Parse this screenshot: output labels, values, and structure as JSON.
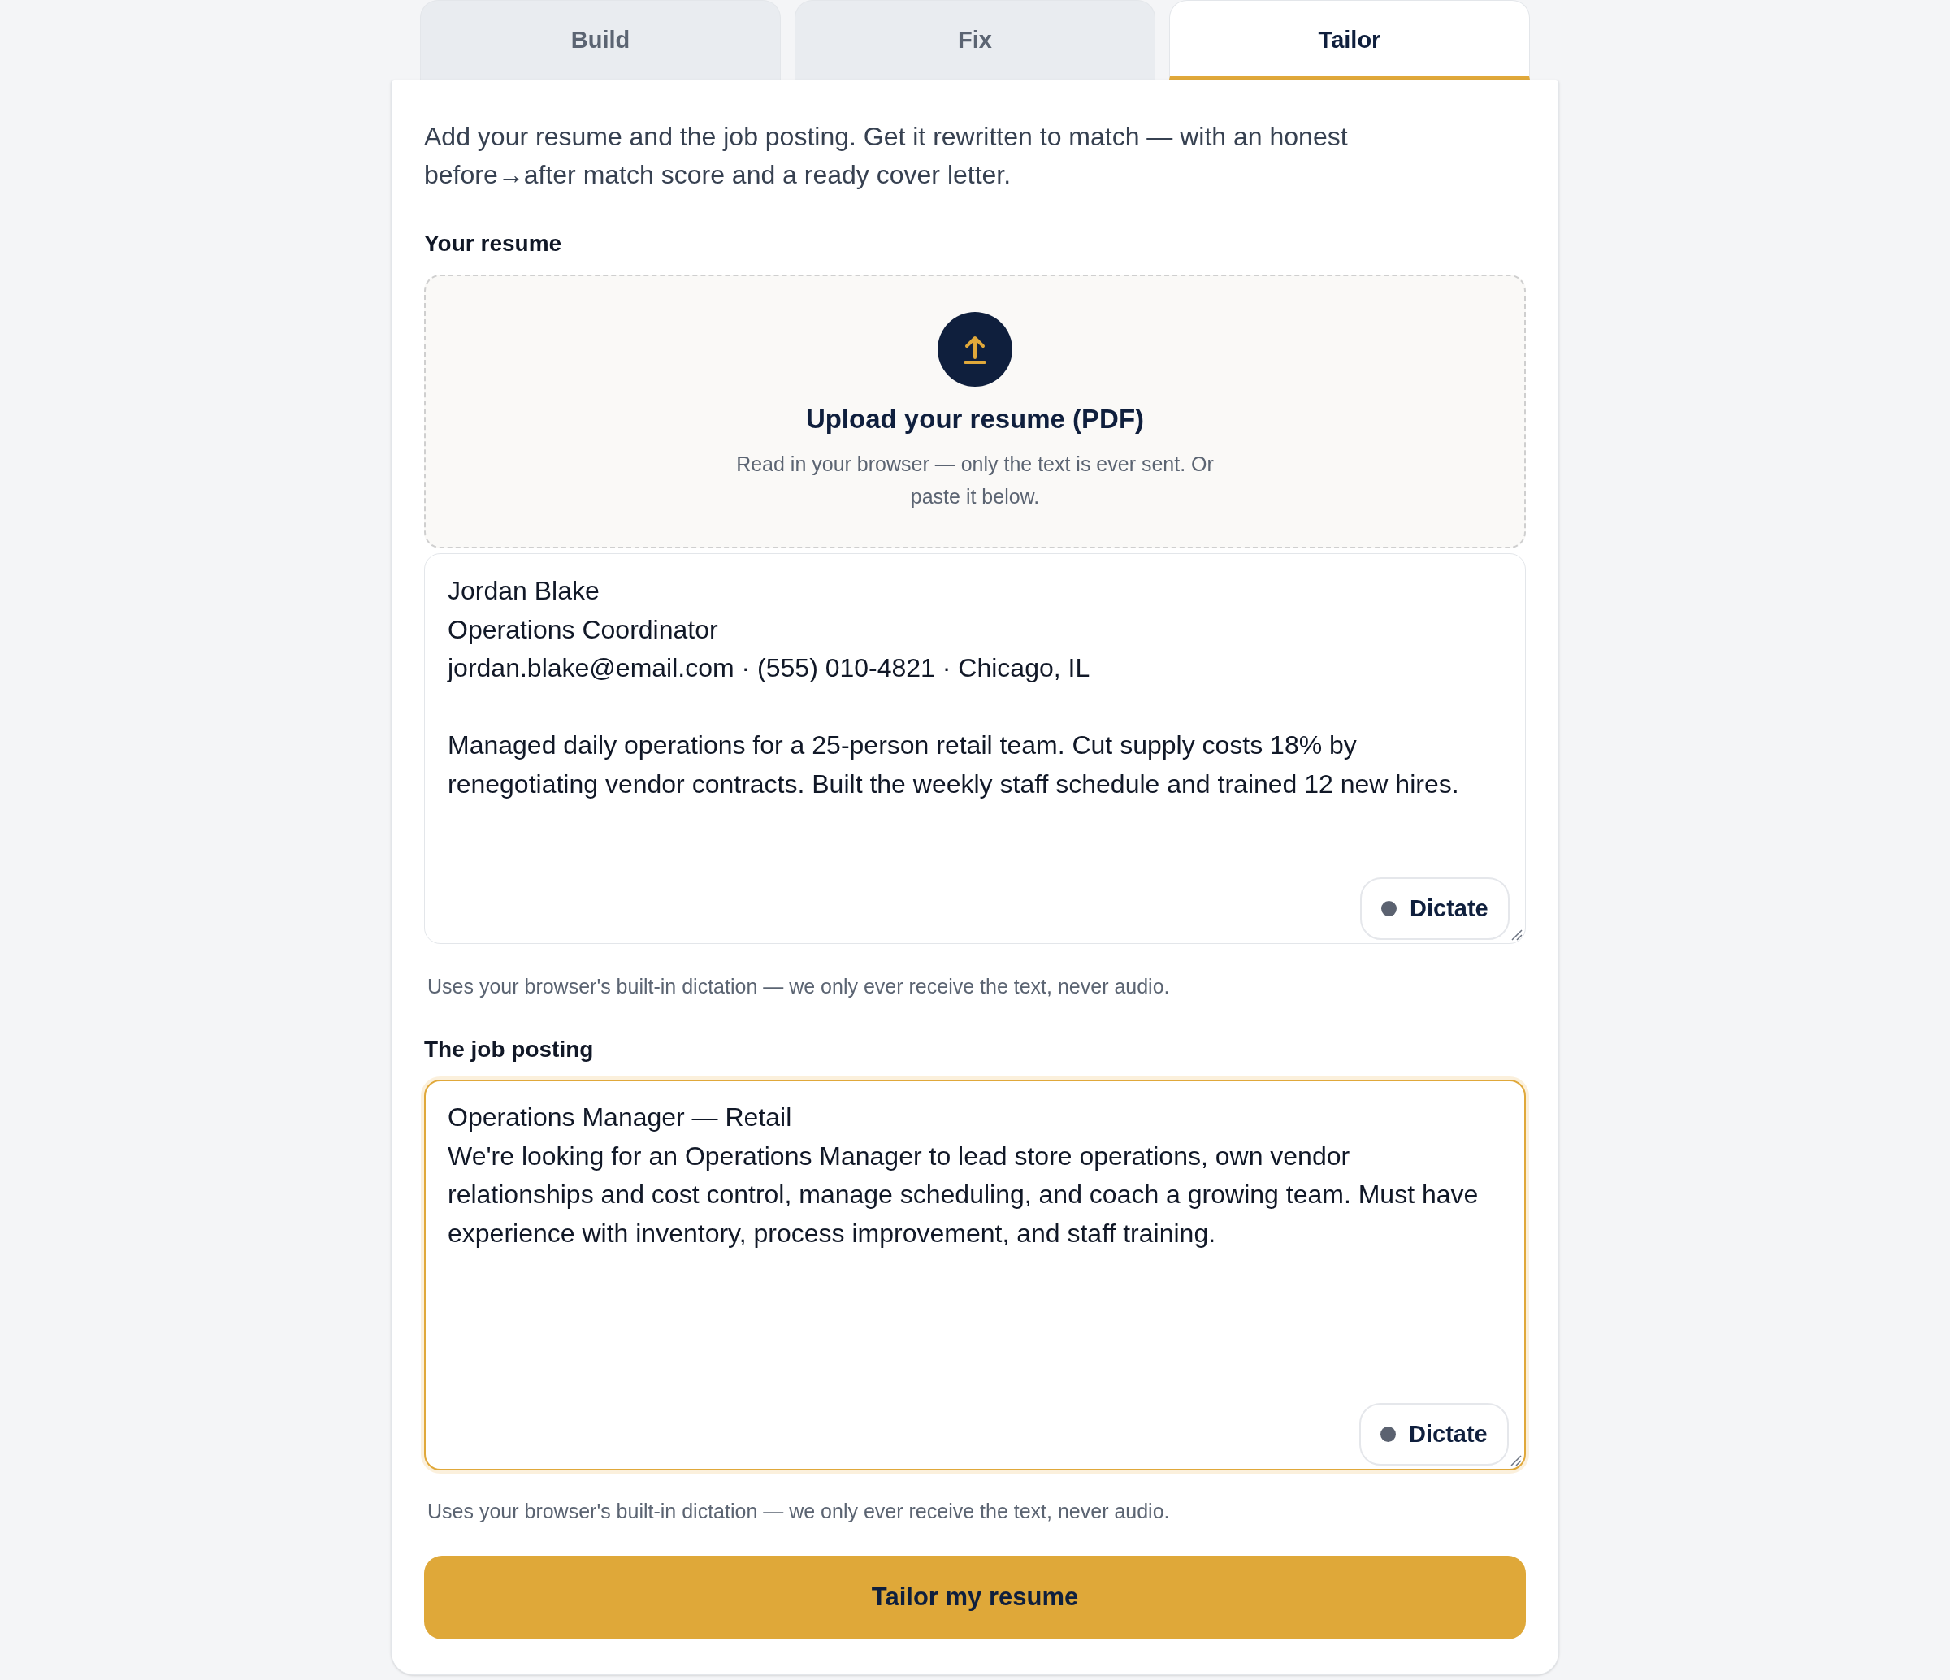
{
  "tabs": [
    {
      "label": "Build",
      "selected": false
    },
    {
      "label": "Fix",
      "selected": false
    },
    {
      "label": "Tailor",
      "selected": true
    }
  ],
  "intro": "Add your resume and the job posting. Get it rewritten to match — with an honest before→after match score and a ready cover letter.",
  "fields": [
    {
      "label": "Your resume",
      "upload": {
        "title": "Upload your resume (PDF)",
        "subtitle": "Read in your browser — only the text is ever sent. Or paste it below."
      },
      "value": "Jordan Blake\nOperations Coordinator\njordan.blake@email.com · (555) 010-4821 · Chicago, IL\n\nManaged daily operations for a 25-person retail team. Cut supply costs 18% by renegotiating vendor contracts. Built the weekly staff schedule and trained 12 new hires.",
      "focused": false,
      "dictate_button": "Dictate",
      "hint": "Uses your browser's built-in dictation — we only ever receive the text, never audio."
    },
    {
      "label": "The job posting",
      "value": "Operations Manager — Retail\nWe're looking for an Operations Manager to lead store operations, own vendor relationships and cost control, manage scheduling, and coach a growing team. Must have experience with inventory, process improvement, and staff training.",
      "focused": true,
      "dictate_button": "Dictate",
      "hint": "Uses your browser's built-in dictation — we only ever receive the text, never audio."
    }
  ],
  "submit_button": "Tailor my resume"
}
